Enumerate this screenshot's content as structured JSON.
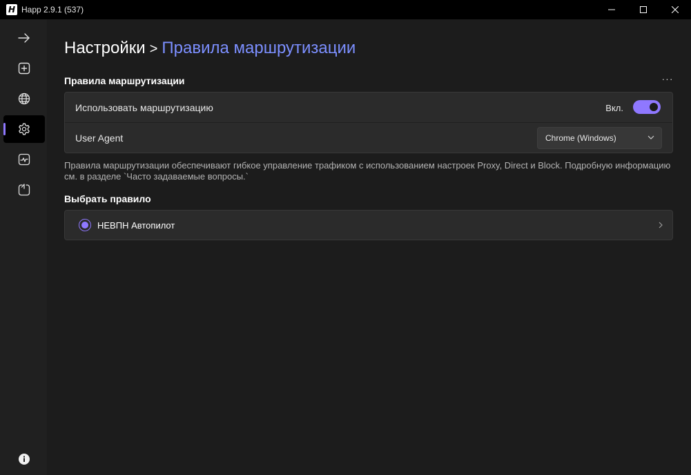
{
  "window": {
    "title": "Happ 2.9.1 (537)",
    "logo_glyph": "H",
    "controls": [
      "minimize-icon",
      "maximize-icon",
      "close-icon"
    ]
  },
  "sidebar": {
    "items": [
      {
        "icon": "arrow-right-icon",
        "active": false
      },
      {
        "icon": "add-square-icon",
        "active": false
      },
      {
        "icon": "globe-icon",
        "active": false
      },
      {
        "icon": "gear-icon",
        "active": true
      },
      {
        "icon": "activity-chart-icon",
        "active": false
      },
      {
        "icon": "power-icon",
        "active": false
      }
    ],
    "footer_icon": "info-icon"
  },
  "breadcrumb": {
    "root": "Настройки",
    "separator": ">",
    "current": "Правила маршрутизации"
  },
  "routing": {
    "section_title": "Правила маршрутизации",
    "more_label": "···",
    "use_routing_label": "Использовать маршрутизацию",
    "toggle_state_label": "Вкл.",
    "toggle_on": true,
    "user_agent_label": "User Agent",
    "user_agent_value": "Chrome (Windows)"
  },
  "description": "Правила маршрутизации обеспечивают гибкое управление трафиком с использованием настроек Proxy, Direct и Block. Подробную информацию см. в разделе `Часто задаваемые вопросы.`",
  "rules": {
    "section_title": "Выбрать правило",
    "selected_rule": "НЕВПН Автопилот"
  },
  "colors": {
    "accent": "#8f78ff",
    "breadcrumb_current": "#7c8fff",
    "background": "#1c1c1c",
    "card": "#2b2b2b"
  }
}
